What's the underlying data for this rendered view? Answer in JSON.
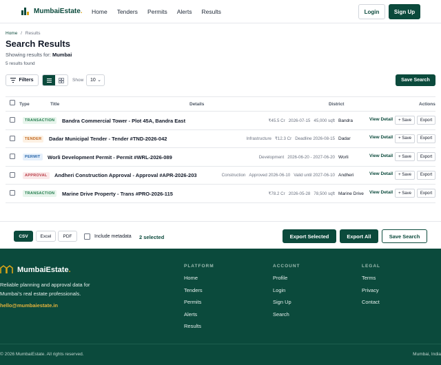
{
  "header": {
    "brand": "MumbaiEstate",
    "brand_dot": ".",
    "nav": [
      "Home",
      "Tenders",
      "Permits",
      "Alerts",
      "Results"
    ],
    "login_label": "Login",
    "signup_label": "Sign Up"
  },
  "breadcrumb": {
    "home": "Home",
    "separator": "/",
    "current": "Results"
  },
  "page": {
    "title": "Search Results",
    "showing_prefix": "Showing results for:",
    "query": "Mumbai",
    "results_count": "5 results found"
  },
  "toolbar": {
    "filters_label": "Filters",
    "show_label": "Show",
    "show_value": "10",
    "save_search_label": "Save Search"
  },
  "table": {
    "columns": {
      "type": "Type",
      "title": "Title",
      "details": "Details",
      "district": "District",
      "actions": "Actions"
    },
    "row_actions": {
      "view": "View Detail",
      "save": "+ Save",
      "export": "Export"
    },
    "rows": [
      {
        "type": "TRANSACTION",
        "title": "Bandra Commercial Tower - Plot 45A, Bandra East",
        "details": [
          "₹45.5 Cr",
          "2026-07-15",
          "45,000 sqft"
        ],
        "district": "Bandra"
      },
      {
        "type": "TENDER",
        "title": "Dadar Municipal Tender - Tender #TND-2026-042",
        "details": [
          "Infrastructure",
          "₹12.3 Cr",
          "Deadline 2026-08-15"
        ],
        "district": "Dadar"
      },
      {
        "type": "PERMIT",
        "title": "Worli Development Permit - Permit #WRL-2026-089",
        "details": [
          "Development",
          "2026-06-20 - 2027-06-20"
        ],
        "district": "Worli"
      },
      {
        "type": "APPROVAL",
        "title": "Andheri Construction Approval - Approval #APR-2026-203",
        "details": [
          "Construction",
          "Approved 2026-06-10",
          "Valid until 2027-06-10"
        ],
        "district": "Andheri"
      },
      {
        "type": "TRANSACTION",
        "title": "Marine Drive Property - Trans #PRO-2026-115",
        "details": [
          "₹78.2 Cr",
          "2026-05-28",
          "78,500 sqft"
        ],
        "district": "Marine Drive"
      }
    ]
  },
  "export_bar": {
    "formats": [
      "CSV",
      "Excel",
      "PDF"
    ],
    "active_format": "CSV",
    "include_metadata_label": "Include metadata",
    "selected_count": "2 selected",
    "export_selected_label": "Export Selected",
    "export_all_label": "Export All",
    "save_search_label": "Save Search"
  },
  "footer": {
    "brand": "MumbaiEstate",
    "brand_dot": ".",
    "tagline": "Reliable planning and approval data for Mumbai's real estate professionals.",
    "email": "hello@mumbaiestate.in",
    "columns": [
      {
        "title": "PLATFORM",
        "items": [
          "Home",
          "Tenders",
          "Permits",
          "Alerts",
          "Results"
        ]
      },
      {
        "title": "ACCOUNT",
        "items": [
          "Profile",
          "Login",
          "Sign Up",
          "Search"
        ]
      },
      {
        "title": "LEGAL",
        "items": [
          "Terms",
          "Privacy",
          "Contact"
        ]
      }
    ],
    "copyright": "© 2026 MumbaiEstate. All rights reserved.",
    "location": "Mumbai, India"
  },
  "colors": {
    "primary": "#0b4a3c",
    "accent": "#d9a518",
    "badge_transaction": "#e7f5ec",
    "badge_tender": "#fdf1e3",
    "badge_permit": "#e6f0fb",
    "badge_approval": "#fbe9ea"
  }
}
